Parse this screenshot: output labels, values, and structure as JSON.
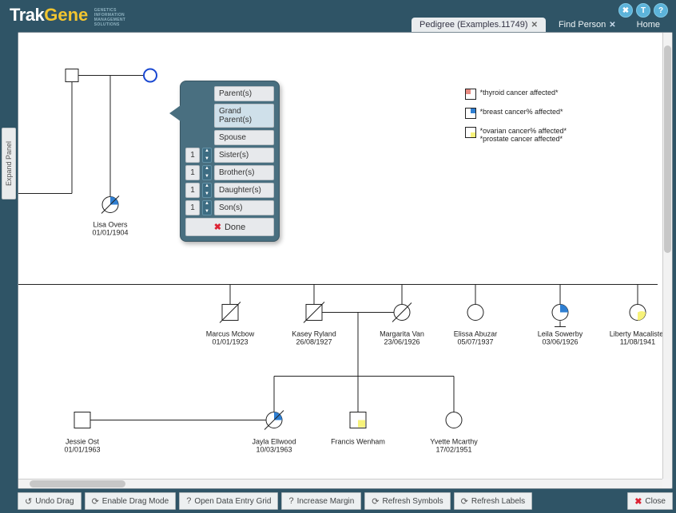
{
  "brand": {
    "trak": "Trak",
    "gene": "Gene",
    "tag": "GENETICS\nINFORMATION\nMANAGEMENT\nSOLUTIONS"
  },
  "header": {
    "icons": {
      "close": "✖",
      "t": "T",
      "help": "?"
    },
    "tabs": {
      "pedigree": "Pedigree (Examples.11749)",
      "find": "Find Person",
      "home": "Home",
      "close": "✕"
    }
  },
  "sidepanel": {
    "label": "Expand Panel"
  },
  "legend": {
    "items": [
      {
        "lines": [
          "*thyroid cancer affected*"
        ],
        "colorQuadrant": "q1",
        "color": "#e98b82"
      },
      {
        "lines": [
          "*breast cancer% affected*"
        ],
        "colorQuadrant": "q2",
        "color": "#2f7fd2"
      },
      {
        "lines": [
          "*ovarian cancer% affected*",
          "*prostate cancer affected*"
        ],
        "colorQuadrant": "q4",
        "color": "#f7f27a"
      }
    ]
  },
  "popup": {
    "count": "1",
    "parents": "Parent(s)",
    "grandparents": "Grand Parent(s)",
    "spouse": "Spouse",
    "sisters": "Sister(s)",
    "brothers": "Brother(s)",
    "daughters": "Daughter(s)",
    "sons": "Son(s)",
    "done": "Done"
  },
  "people": {
    "lisa": {
      "name": "Lisa Overs",
      "dob": "01/01/1904"
    },
    "marcus": {
      "name": "Marcus Mcbow",
      "dob": "01/01/1923"
    },
    "kasey": {
      "name": "Kasey Ryland",
      "dob": "26/08/1927"
    },
    "margarita": {
      "name": "Margarita Van",
      "dob": "23/06/1926"
    },
    "elissa": {
      "name": "Elissa Abuzar",
      "dob": "05/07/1937"
    },
    "leila": {
      "name": "Leila Sowerby",
      "dob": "03/06/1926"
    },
    "liberty": {
      "name": "Liberty Macalister",
      "dob": "11/08/1941"
    },
    "jessie": {
      "name": "Jessie Ost",
      "dob": "01/01/1963"
    },
    "jayla": {
      "name": "Jayla Ellwood",
      "dob": "10/03/1963"
    },
    "francis": {
      "name": "Francis Wenham",
      "dob": ""
    },
    "yvette": {
      "name": "Yvette Mcarthy",
      "dob": "17/02/1951"
    }
  },
  "toolbar": {
    "undo": "Undo Drag",
    "drag": "Enable Drag Mode",
    "grid": "Open Data Entry Grid",
    "margin": "Increase Margin",
    "symbols": "Refresh Symbols",
    "labels": "Refresh Labels",
    "close": "Close"
  }
}
